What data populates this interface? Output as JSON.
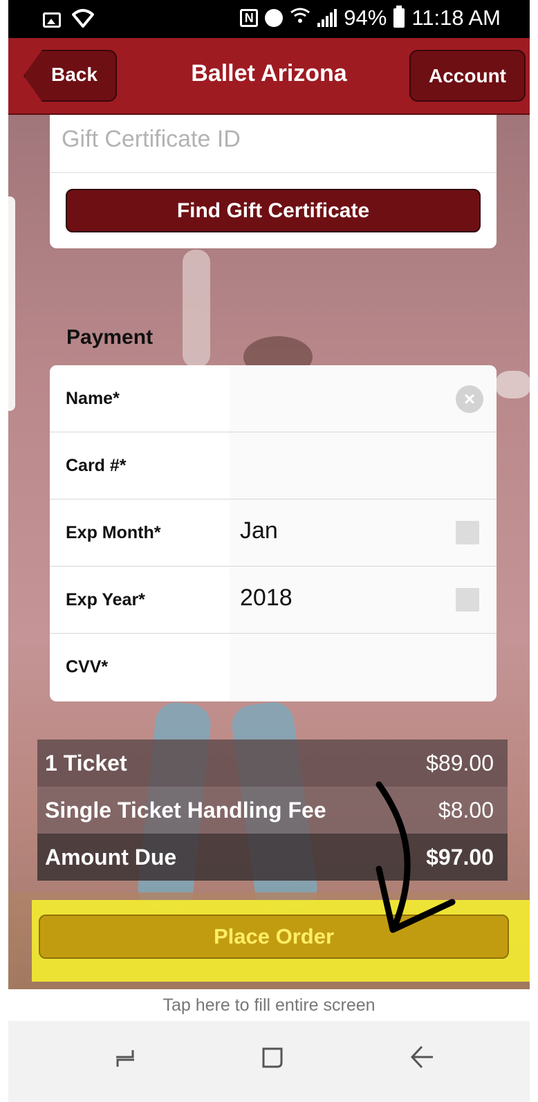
{
  "status_bar": {
    "battery": "94%",
    "time": "11:18 AM",
    "icons": [
      "gallery-icon",
      "wifi-icon",
      "nfc-icon",
      "alarm-icon",
      "wifi-signal-icon",
      "signal-bars-icon",
      "battery-icon"
    ]
  },
  "nav": {
    "back_label": "Back",
    "title": "Ballet Arizona",
    "account_label": "Account"
  },
  "gift": {
    "placeholder": "Gift Certificate ID",
    "find_label": "Find Gift Certificate"
  },
  "payment": {
    "heading": "Payment",
    "fields": [
      {
        "label": "Name*",
        "value": ""
      },
      {
        "label": "Card #*",
        "value": ""
      },
      {
        "label": "Exp Month*",
        "value": "Jan"
      },
      {
        "label": "Exp Year*",
        "value": "2018"
      },
      {
        "label": "CVV*",
        "value": ""
      }
    ]
  },
  "summary": {
    "rows": [
      {
        "label": "1 Ticket",
        "amount": "$89.00"
      },
      {
        "label": "Single Ticket Handling Fee",
        "amount": "$8.00"
      },
      {
        "label": "Amount Due",
        "amount": "$97.00"
      }
    ]
  },
  "place_order_label": "Place Order",
  "fill_screen_text": "Tap here to fill entire screen",
  "colors": {
    "brand": "#9e1b22",
    "button_dark": "#6e0f14",
    "highlight": "#ffff28",
    "place_order": "#c29c10"
  }
}
